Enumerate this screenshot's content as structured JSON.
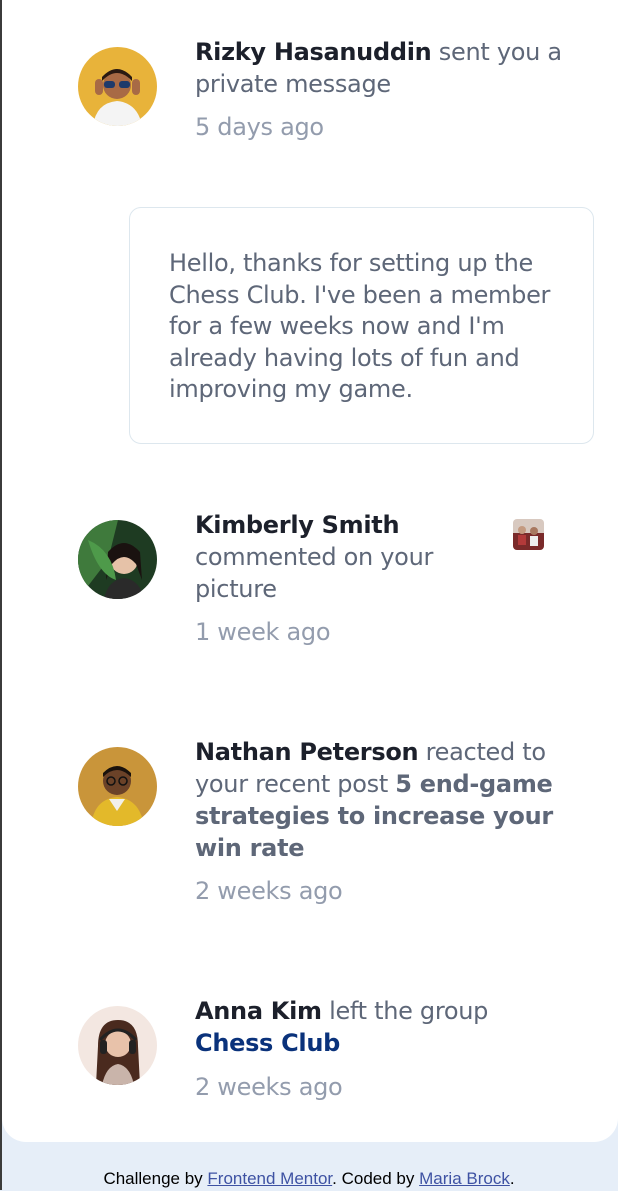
{
  "notifications": [
    {
      "name": "Rizky Hasanuddin",
      "action": "sent you a private message",
      "time": "5 days ago",
      "message": "Hello, thanks for setting up the Chess Club. I've been a member for a few weeks now and I'm already having lots of fun and improving my game.",
      "avatar_icon": "avatar-rizky"
    },
    {
      "name": "Kimberly Smith",
      "action": "commented on your picture",
      "time": "1 week ago",
      "avatar_icon": "avatar-kimberly",
      "thumb_icon": "chess-picture-thumbnail"
    },
    {
      "name": "Nathan Peterson",
      "action": "reacted to your recent post",
      "post": "5 end-game strategies to increase your win rate",
      "time": "2 weeks ago",
      "avatar_icon": "avatar-nathan"
    },
    {
      "name": "Anna Kim",
      "action": "left the group",
      "group": "Chess Club",
      "time": "2 weeks ago",
      "avatar_icon": "avatar-anna"
    }
  ],
  "footer": {
    "prefix": "Challenge by",
    "link1": "Frontend Mentor",
    "middle": ". Coded by",
    "link2": "Maria Brock",
    "suffix": "."
  },
  "colors": {
    "name": "#1c202b",
    "text": "#5e6778",
    "time": "#939cad",
    "group": "#0a327b",
    "page_bg": "#e6eef8",
    "card_bg": "#ffffff"
  }
}
